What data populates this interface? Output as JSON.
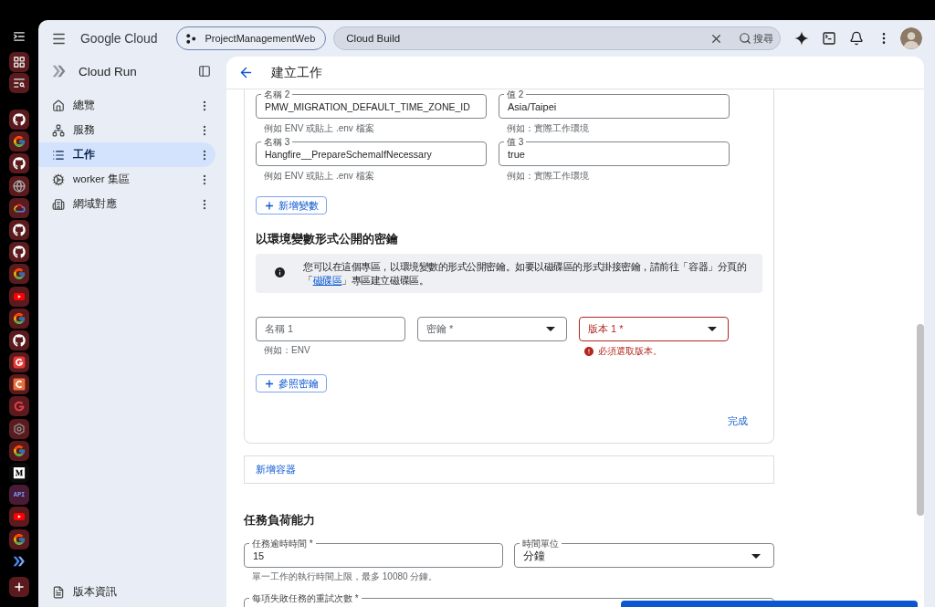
{
  "dock": {
    "api_label": "API"
  },
  "top_bar": {
    "brand": "Google Cloud",
    "project": "ProjectManagementWeb",
    "search": {
      "value": "Cloud Build",
      "button": "搜尋"
    }
  },
  "sidebar": {
    "title": "Cloud Run",
    "items": [
      {
        "label": "總覽",
        "selected": false
      },
      {
        "label": "服務",
        "selected": false
      },
      {
        "label": "工作",
        "selected": true
      },
      {
        "label": "worker 集區",
        "selected": false
      },
      {
        "label": "網域對應",
        "selected": false
      }
    ],
    "footer_link": "版本資訊"
  },
  "page": {
    "title": "建立工作"
  },
  "env_vars": {
    "rows": [
      {
        "name_label": "名稱 2",
        "name": "PMW_MIGRATION_DEFAULT_TIME_ZONE_ID",
        "name_hint": "例如 ENV 或貼上 .env 檔案",
        "value_label": "值 2",
        "value": "Asia/Taipei",
        "value_hint": "例如：實際工作環境"
      },
      {
        "name_label": "名稱 3",
        "name": "Hangfire__PrepareSchemaIfNecessary",
        "name_hint": "例如 ENV 或貼上 .env 檔案",
        "value_label": "值 3",
        "value": "true",
        "value_hint": "例如：實際工作環境"
      }
    ],
    "add_button": "新增變數"
  },
  "secrets": {
    "heading": "以環境變數形式公開的密鑰",
    "info": {
      "text_before": "您可以在這個專區，以環境變數的形式公開密鑰。如要以磁碟區的形式掛接密鑰，請前往「容器」分頁的「",
      "link": "磁碟區",
      "text_after": "」專區建立磁碟區。"
    },
    "name": {
      "placeholder": "名稱 1",
      "hint": "例如：ENV"
    },
    "secret": {
      "placeholder": "密鑰 *"
    },
    "version": {
      "placeholder": "版本 1 *",
      "invalid": true,
      "error": "必須選取版本。"
    },
    "add_button": "參照密鑰",
    "done_button": "完成"
  },
  "add_container": "新增容器",
  "task_capacity": {
    "heading": "任務負荷能力",
    "timeout": {
      "label": "任務逾時時間 *",
      "value": "15",
      "hint": "單一工作的執行時間上限，最多 10080 分鐘。"
    },
    "time_unit": {
      "label": "時間單位",
      "value": "分鐘"
    },
    "retries": {
      "label": "每項失敗任務的重試次數 *"
    }
  }
}
